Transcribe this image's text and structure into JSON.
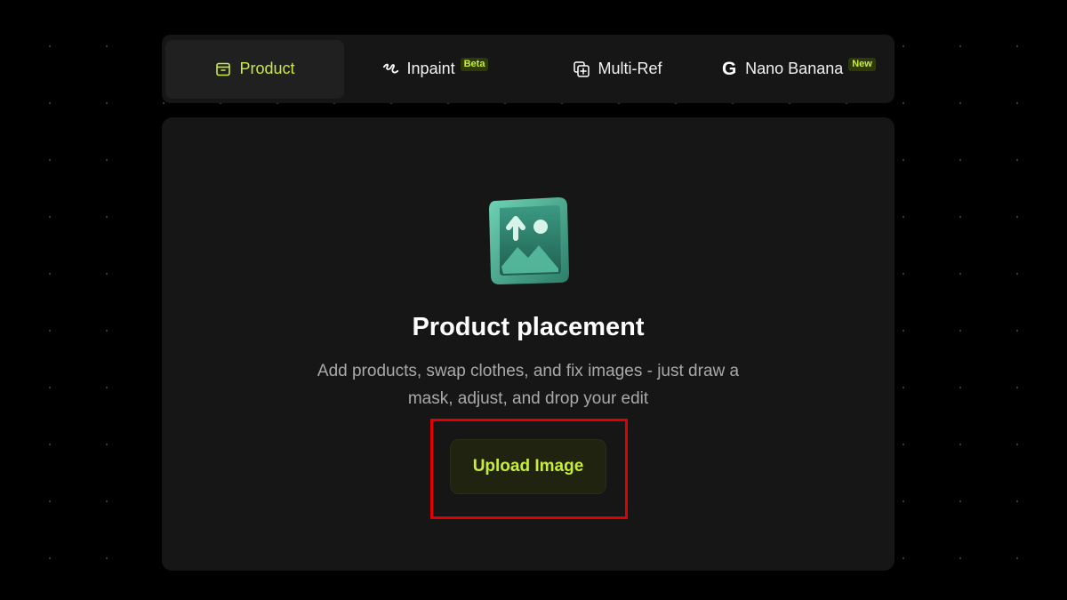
{
  "tabs": [
    {
      "label": "Product",
      "icon": "archive-box-icon",
      "active": true
    },
    {
      "label": "Inpaint",
      "icon": "brush-squiggle-icon",
      "badge": "Beta"
    },
    {
      "label": "Multi-Ref",
      "icon": "stack-plus-icon"
    },
    {
      "label": "Nano Banana",
      "icon": "google-g-icon",
      "icon_text": "G",
      "badge": "New"
    }
  ],
  "main": {
    "icon": "image-upload-icon",
    "title": "Product placement",
    "description": "Add products, swap clothes, and fix images - just draw a mask, adjust, and drop your edit",
    "upload_button": "Upload Image"
  },
  "colors": {
    "accent": "#c8ec3a",
    "highlight": "#e00000",
    "background": "#000000",
    "panel": "#161616"
  }
}
